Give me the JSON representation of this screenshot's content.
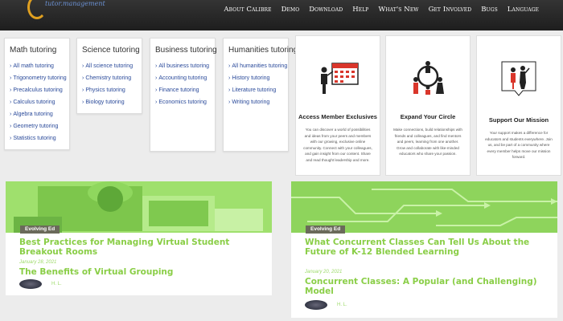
{
  "header": {
    "tagline": "tutor.management",
    "nav": [
      "About Calibre",
      "Demo",
      "Download",
      "Help",
      "What's New",
      "Get Involved",
      "Bugs",
      "Language"
    ]
  },
  "tutoring": [
    {
      "title": "Math tutoring",
      "items": [
        "All math tutoring",
        "Trigonometry tutoring",
        "Precalculus tutoring",
        "Calculus tutoring",
        "Algebra tutoring",
        "Geometry tutoring",
        "Statistics tutoring"
      ]
    },
    {
      "title": "Science tutoring",
      "items": [
        "All science tutoring",
        "Chemistry tutoring",
        "Physics tutoring",
        "Biology tutoring"
      ]
    },
    {
      "title": "Business tutoring",
      "items": [
        "All business tutoring",
        "Accounting tutoring",
        "Finance tutoring",
        "Economics tutoring"
      ]
    },
    {
      "title": "Humanities tutoring",
      "items": [
        "All humanities tutoring",
        "History tutoring",
        "Literature tutoring",
        "Writing tutoring"
      ]
    }
  ],
  "membership": [
    {
      "title": "Access Member Exclusives",
      "text": "You can discover a world of possibilities and ideas from your peers and members with our growing, exclusive online community. Connect with your colleagues, and gain insight from our content. Share and read thought leadership and more."
    },
    {
      "title": "Expand Your Circle",
      "text": "Make connections, build relationships with friends and colleagues, and find mentors and peers, learning from one another. Grow and collaborate with like-minded educators who share your passion."
    },
    {
      "title": "Support Our Mission",
      "text": "Your support makes a difference for educators and students everywhere. Join us, and be part of a community where every member helps move our mission forward."
    }
  ],
  "articles": [
    {
      "badge": "Evolving Ed",
      "title": "Best Practices for Managing Virtual Student Breakout Rooms",
      "date": "January 28, 2021",
      "subtitle": "The Benefits of Virtual Grouping",
      "author": "H. L."
    },
    {
      "badge": "Evolving Ed",
      "title": "What Concurrent Classes Can Tell Us About the Future of K-12 Blended Learning",
      "date": "January 20, 2021",
      "subtitle": "Concurrent Classes: A Popular (and Challenging) Model",
      "author": "H. L."
    }
  ]
}
